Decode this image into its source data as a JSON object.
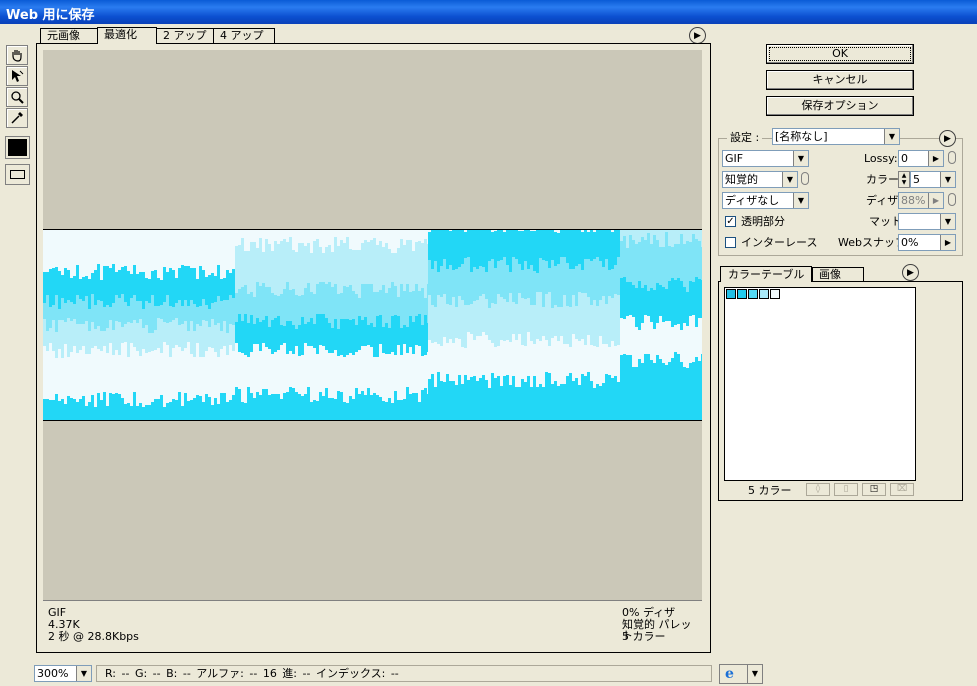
{
  "window": {
    "title": "Web 用に保存"
  },
  "tabs": [
    {
      "label": "元画像"
    },
    {
      "label": "最適化"
    },
    {
      "label": "2 アップ"
    },
    {
      "label": "4 アップ"
    }
  ],
  "image_info": {
    "format": "GIF",
    "size": "4.37K",
    "time": "2 秒 @ 28.8Kbps",
    "dither": "0% ディザ",
    "palette": "知覚的 パレット",
    "colors": "5 カラー"
  },
  "status": {
    "zoom": "300%",
    "pixel_info": "R:  --   G:  --   B:  --   アルファ:   --  16 進:    --  インデックス:    --"
  },
  "buttons": {
    "ok": "OK",
    "cancel": "キャンセル",
    "save_options": "保存オプション"
  },
  "settings": {
    "label": "設定 :",
    "preset": "[名称なし]",
    "format": "GIF",
    "reduction": "知覚的",
    "dither_algo": "ディザなし",
    "lossy_label": "Lossy:",
    "lossy_value": "0",
    "colors_label": "カラー:",
    "colors_value": "5",
    "dither_label": "ディザ:",
    "dither_value": "88%",
    "transparency_label": "透明部分",
    "transparency_checked": true,
    "interlace_label": "インターレース",
    "interlace_checked": false,
    "matte_label": "マット:",
    "matte_value": "",
    "websnap_label": "Webスナップ:",
    "websnap_value": "0%"
  },
  "color_table": {
    "tabs": [
      "カラーテーブル",
      "画像"
    ],
    "count_label": "5 カラー",
    "swatches": [
      "#22bfe6",
      "#22cbee",
      "#55d8f3",
      "#a9e9f8",
      "#f0fafd"
    ]
  },
  "image_colors": [
    "#22d7f6",
    "#7fe4f7",
    "#b8eef9",
    "#f0fafd"
  ]
}
